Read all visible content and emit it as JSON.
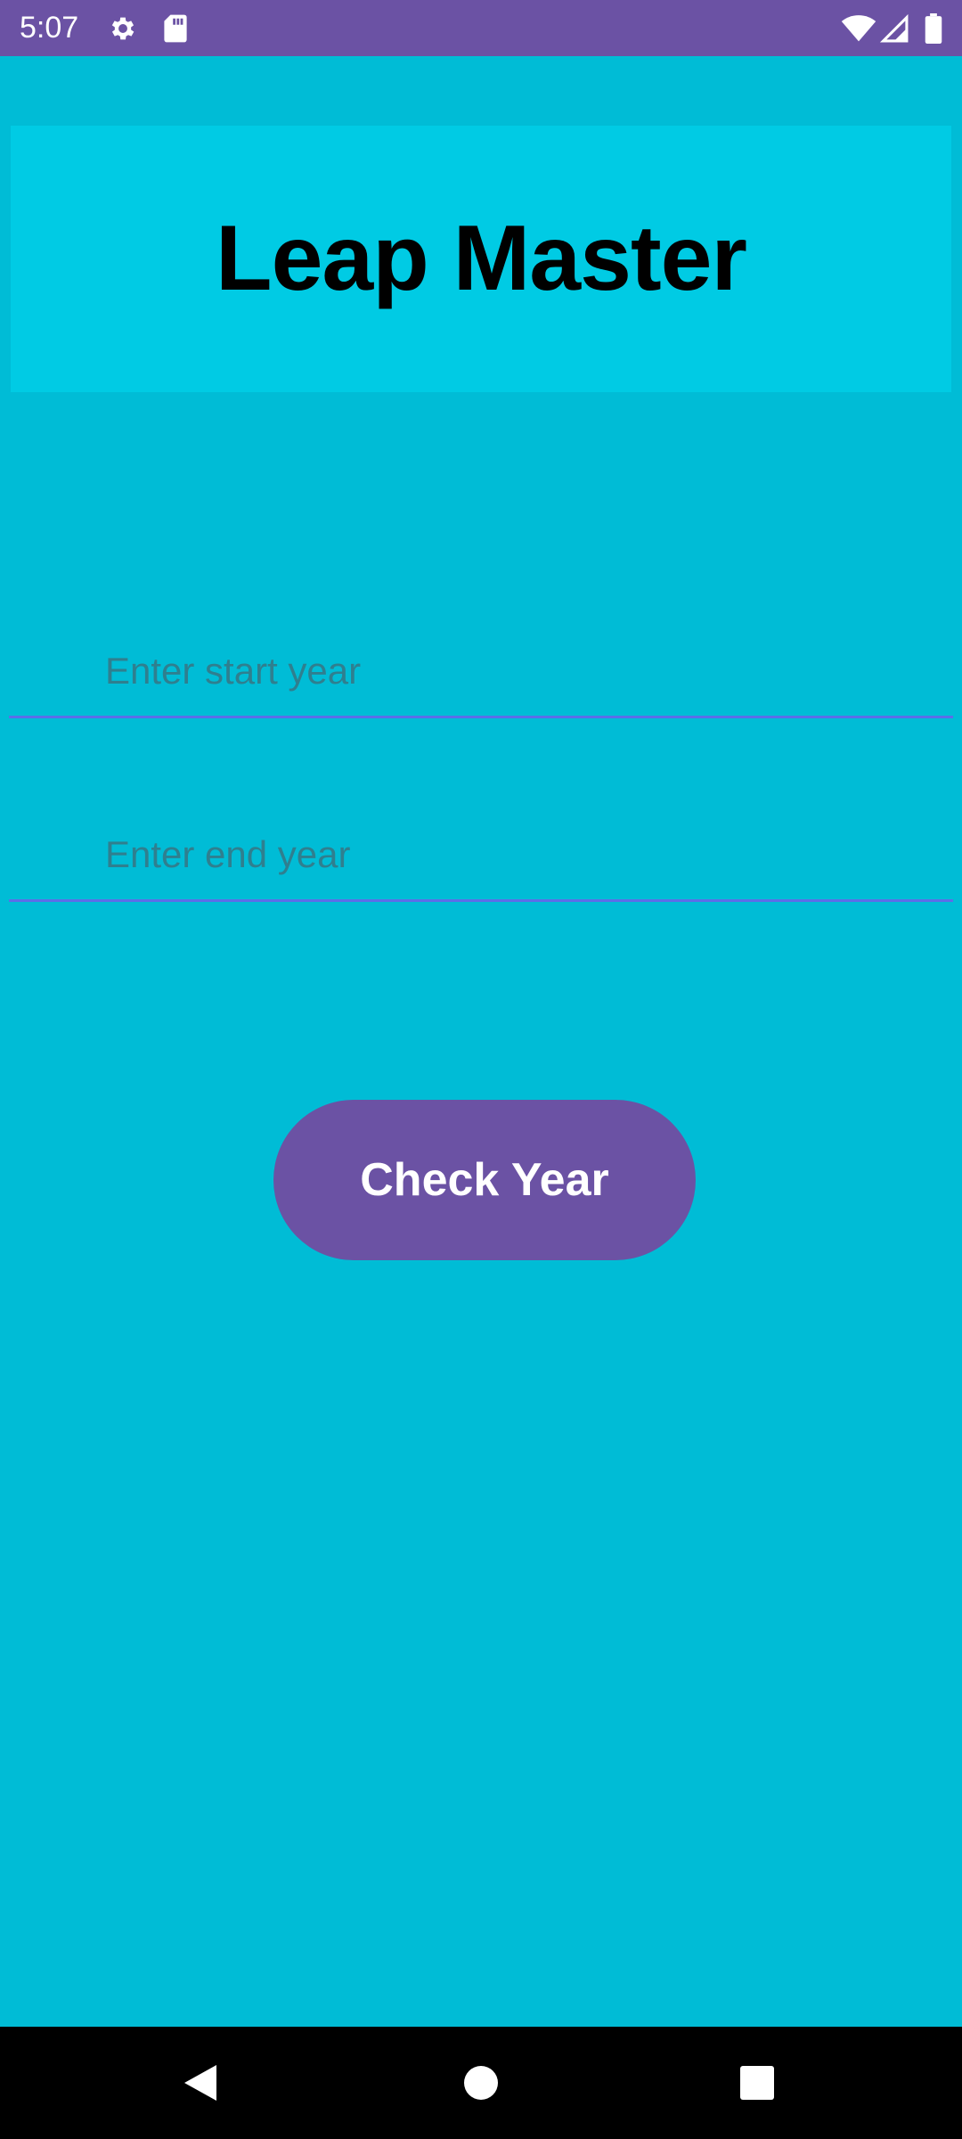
{
  "status_bar": {
    "time": "5:07",
    "icons": [
      "gear-icon",
      "sd-card-icon",
      "wifi-icon",
      "signal-icon",
      "battery-icon"
    ],
    "background": "#6b52a4"
  },
  "app": {
    "background": "#00bcd6",
    "header_background": "#00cbe4",
    "title": "Leap Master"
  },
  "form": {
    "start_year": {
      "value": "",
      "placeholder": "Enter start year"
    },
    "end_year": {
      "value": "",
      "placeholder": "Enter end year"
    },
    "check_button_label": "Check Year",
    "accent": "#6b52a4",
    "underline": "#5b6ee8"
  },
  "nav_bar": {
    "icons": [
      "back-icon",
      "home-icon",
      "recents-icon"
    ]
  }
}
